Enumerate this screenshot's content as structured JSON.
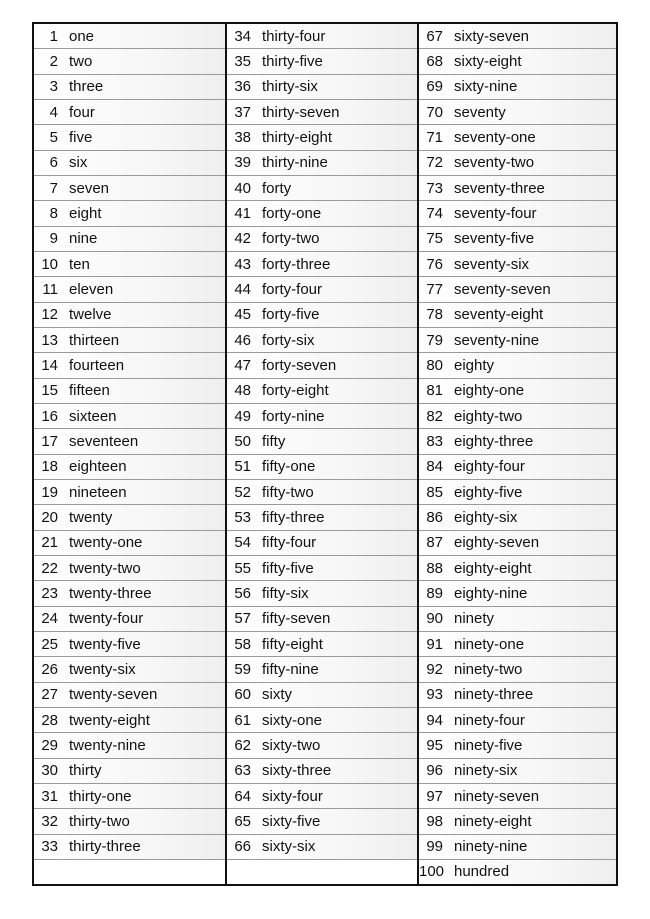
{
  "columns": [
    [
      [
        "1",
        "one"
      ],
      [
        "2",
        "two"
      ],
      [
        "3",
        "three"
      ],
      [
        "4",
        "four"
      ],
      [
        "5",
        "five"
      ],
      [
        "6",
        "six"
      ],
      [
        "7",
        "seven"
      ],
      [
        "8",
        "eight"
      ],
      [
        "9",
        "nine"
      ],
      [
        "10",
        "ten"
      ],
      [
        "11",
        "eleven"
      ],
      [
        "12",
        "twelve"
      ],
      [
        "13",
        "thirteen"
      ],
      [
        "14",
        "fourteen"
      ],
      [
        "15",
        "fifteen"
      ],
      [
        "16",
        "sixteen"
      ],
      [
        "17",
        "seventeen"
      ],
      [
        "18",
        "eighteen"
      ],
      [
        "19",
        "nineteen"
      ],
      [
        "20",
        "twenty"
      ],
      [
        "21",
        "twenty-one"
      ],
      [
        "22",
        "twenty-two"
      ],
      [
        "23",
        "twenty-three"
      ],
      [
        "24",
        "twenty-four"
      ],
      [
        "25",
        "twenty-five"
      ],
      [
        "26",
        "twenty-six"
      ],
      [
        "27",
        "twenty-seven"
      ],
      [
        "28",
        "twenty-eight"
      ],
      [
        "29",
        "twenty-nine"
      ],
      [
        "30",
        "thirty"
      ],
      [
        "31",
        "thirty-one"
      ],
      [
        "32",
        "thirty-two"
      ],
      [
        "33",
        "thirty-three"
      ]
    ],
    [
      [
        "34",
        "thirty-four"
      ],
      [
        "35",
        "thirty-five"
      ],
      [
        "36",
        "thirty-six"
      ],
      [
        "37",
        "thirty-seven"
      ],
      [
        "38",
        "thirty-eight"
      ],
      [
        "39",
        "thirty-nine"
      ],
      [
        "40",
        "forty"
      ],
      [
        "41",
        "forty-one"
      ],
      [
        "42",
        "forty-two"
      ],
      [
        "43",
        "forty-three"
      ],
      [
        "44",
        "forty-four"
      ],
      [
        "45",
        "forty-five"
      ],
      [
        "46",
        "forty-six"
      ],
      [
        "47",
        "forty-seven"
      ],
      [
        "48",
        "forty-eight"
      ],
      [
        "49",
        "forty-nine"
      ],
      [
        "50",
        "fifty"
      ],
      [
        "51",
        "fifty-one"
      ],
      [
        "52",
        "fifty-two"
      ],
      [
        "53",
        "fifty-three"
      ],
      [
        "54",
        "fifty-four"
      ],
      [
        "55",
        "fifty-five"
      ],
      [
        "56",
        "fifty-six"
      ],
      [
        "57",
        "fifty-seven"
      ],
      [
        "58",
        "fifty-eight"
      ],
      [
        "59",
        "fifty-nine"
      ],
      [
        "60",
        "sixty"
      ],
      [
        "61",
        "sixty-one"
      ],
      [
        "62",
        "sixty-two"
      ],
      [
        "63",
        "sixty-three"
      ],
      [
        "64",
        "sixty-four"
      ],
      [
        "65",
        "sixty-five"
      ],
      [
        "66",
        "sixty-six"
      ]
    ],
    [
      [
        "67",
        "sixty-seven"
      ],
      [
        "68",
        "sixty-eight"
      ],
      [
        "69",
        "sixty-nine"
      ],
      [
        "70",
        "seventy"
      ],
      [
        "71",
        "seventy-one"
      ],
      [
        "72",
        "seventy-two"
      ],
      [
        "73",
        "seventy-three"
      ],
      [
        "74",
        "seventy-four"
      ],
      [
        "75",
        "seventy-five"
      ],
      [
        "76",
        "seventy-six"
      ],
      [
        "77",
        "seventy-seven"
      ],
      [
        "78",
        "seventy-eight"
      ],
      [
        "79",
        "seventy-nine"
      ],
      [
        "80",
        "eighty"
      ],
      [
        "81",
        "eighty-one"
      ],
      [
        "82",
        "eighty-two"
      ],
      [
        "83",
        "eighty-three"
      ],
      [
        "84",
        "eighty-four"
      ],
      [
        "85",
        "eighty-five"
      ],
      [
        "86",
        "eighty-six"
      ],
      [
        "87",
        "eighty-seven"
      ],
      [
        "88",
        "eighty-eight"
      ],
      [
        "89",
        "eighty-nine"
      ],
      [
        "90",
        "ninety"
      ],
      [
        "91",
        "ninety-one"
      ],
      [
        "92",
        "ninety-two"
      ],
      [
        "93",
        "ninety-three"
      ],
      [
        "94",
        "ninety-four"
      ],
      [
        "95",
        "ninety-five"
      ],
      [
        "96",
        "ninety-six"
      ],
      [
        "97",
        "ninety-seven"
      ],
      [
        "98",
        "ninety-eight"
      ],
      [
        "99",
        "ninety-nine"
      ],
      [
        "100",
        "hundred"
      ]
    ]
  ]
}
